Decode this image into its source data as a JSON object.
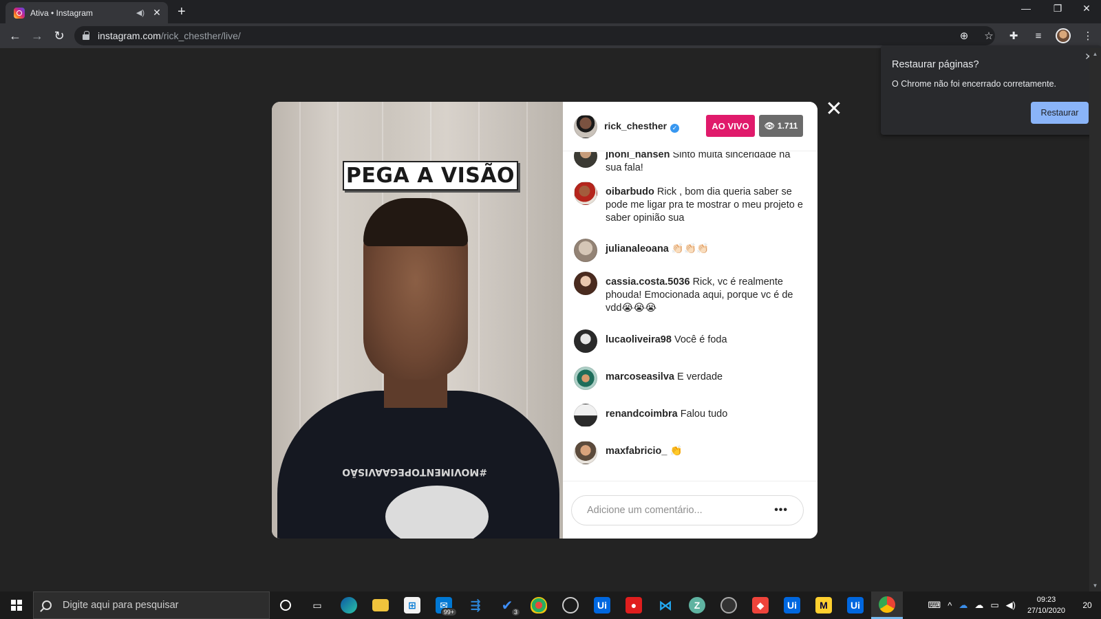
{
  "browser": {
    "tab_title": "Ativa • Instagram",
    "tab_audio_icon": "speaker-icon",
    "new_tab_label": "+",
    "window_controls": {
      "minimize": "—",
      "restore": "❐",
      "close": "✕"
    },
    "url_host": "instagram.com",
    "url_path": "/rick_chesther/live/"
  },
  "restore_bubble": {
    "title": "Restaurar páginas?",
    "message": "O Chrome não foi encerrado corretamente.",
    "button_label": "Restaurar",
    "close_label": "✕"
  },
  "live": {
    "host_username": "rick_chesther",
    "verified_mark": "✓",
    "live_label": "AO VIVO",
    "viewer_count": "1.711",
    "sign_text": "PEGA A VISÃO",
    "shirt_text": "#MOVIMENTOPEGAAVISÃO",
    "comment_placeholder": "Adicione um comentário...",
    "more_label": "•••",
    "close_label": "✕",
    "comments": [
      {
        "user": "jhoni_hansen",
        "text": "Sinto muita sinceridade na sua fala!"
      },
      {
        "user": "oibarbudo",
        "text": "Rick , bom dia queria saber se pode me ligar pra te mostrar o meu projeto e saber opinião sua"
      },
      {
        "user": "julianaleoana",
        "text": "👏🏻👏🏻👏🏻"
      },
      {
        "user": "cassia.costa.5036",
        "text": "Rick, vc é realmente phouda! Emocionada aqui, porque vc é de vdd😭😭😭"
      },
      {
        "user": "lucaoliveira98",
        "text": "Você é foda"
      },
      {
        "user": "marcoseasilva",
        "text": "E verdade"
      },
      {
        "user": "renandcoimbra",
        "text": "Falou tudo"
      },
      {
        "user": "maxfabricio_",
        "text": "👏"
      }
    ]
  },
  "taskbar": {
    "search_placeholder": "Digite aqui para pesquisar",
    "store_badge": "99+",
    "todo_badge": "3",
    "time": "09:23",
    "date": "27/10/2020",
    "notification_count": "20",
    "apps": [
      "cortana",
      "task-view",
      "edge",
      "file-explorer",
      "store",
      "mail",
      "azure-devops",
      "todo",
      "vpn",
      "obs",
      "uipath-studio",
      "screen-recorder",
      "vscode",
      "zoom",
      "obs-studio",
      "anydesk",
      "uipath-assistant",
      "miro",
      "uipath-robot",
      "chrome"
    ]
  }
}
